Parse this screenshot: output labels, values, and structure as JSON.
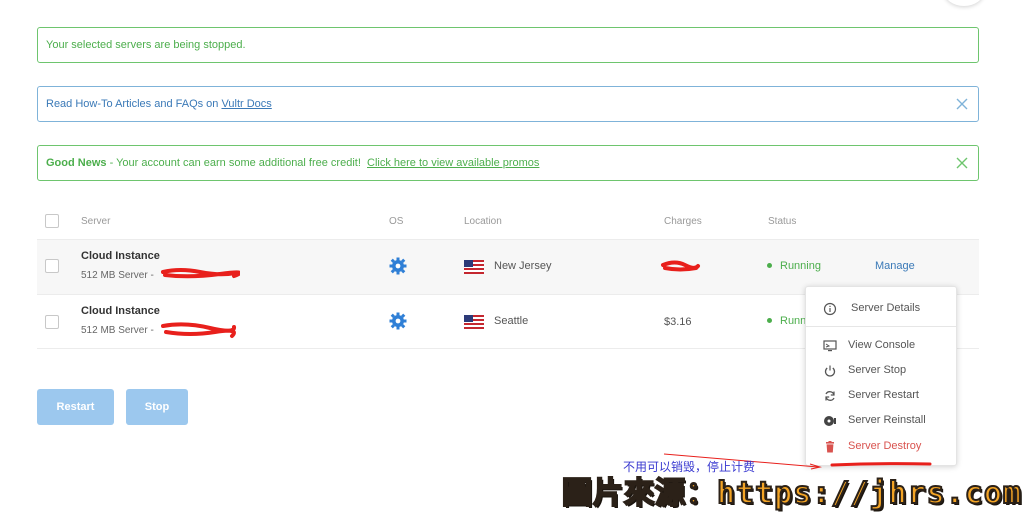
{
  "alerts": {
    "stopped": "Your selected servers are being stopped.",
    "docs_prefix": "Read How-To Articles and FAQs on ",
    "docs_link": "Vultr Docs",
    "promo_bold": "Good News",
    "promo_text": " - Your account can earn some additional free credit!  ",
    "promo_link": "Click here to view available promos"
  },
  "table": {
    "headers": {
      "server": "Server",
      "os": "OS",
      "location": "Location",
      "charges": "Charges",
      "status": "Status"
    },
    "rows": [
      {
        "name": "Cloud Instance",
        "plan": "512 MB Server - ",
        "location": "New Jersey",
        "charges": "",
        "status": "Running",
        "action": "Manage"
      },
      {
        "name": "Cloud Instance",
        "plan": "512 MB Server - ",
        "location": "Seattle",
        "charges": "$3.16",
        "status": "Runn",
        "action": ""
      }
    ]
  },
  "buttons": {
    "restart": "Restart",
    "stop": "Stop"
  },
  "menu": {
    "items": [
      {
        "label": "Server Details",
        "icon": "info-icon"
      },
      {
        "label": "View Console",
        "icon": "monitor-icon"
      },
      {
        "label": "Server Stop",
        "icon": "power-icon"
      },
      {
        "label": "Server Restart",
        "icon": "refresh-icon"
      },
      {
        "label": "Server Reinstall",
        "icon": "reinstall-icon"
      },
      {
        "label": "Server Destroy",
        "icon": "trash-icon"
      }
    ]
  },
  "annotation": "不用可以销毁，停止计费",
  "watermark": "圖片來源：https://jhrs.com",
  "colors": {
    "success": "#4cae4c",
    "link": "#3a79b7",
    "button": "#9cc8ee",
    "danger": "#d9534f",
    "annotation": "#3a3ad0",
    "watermark": "#f3a425"
  }
}
